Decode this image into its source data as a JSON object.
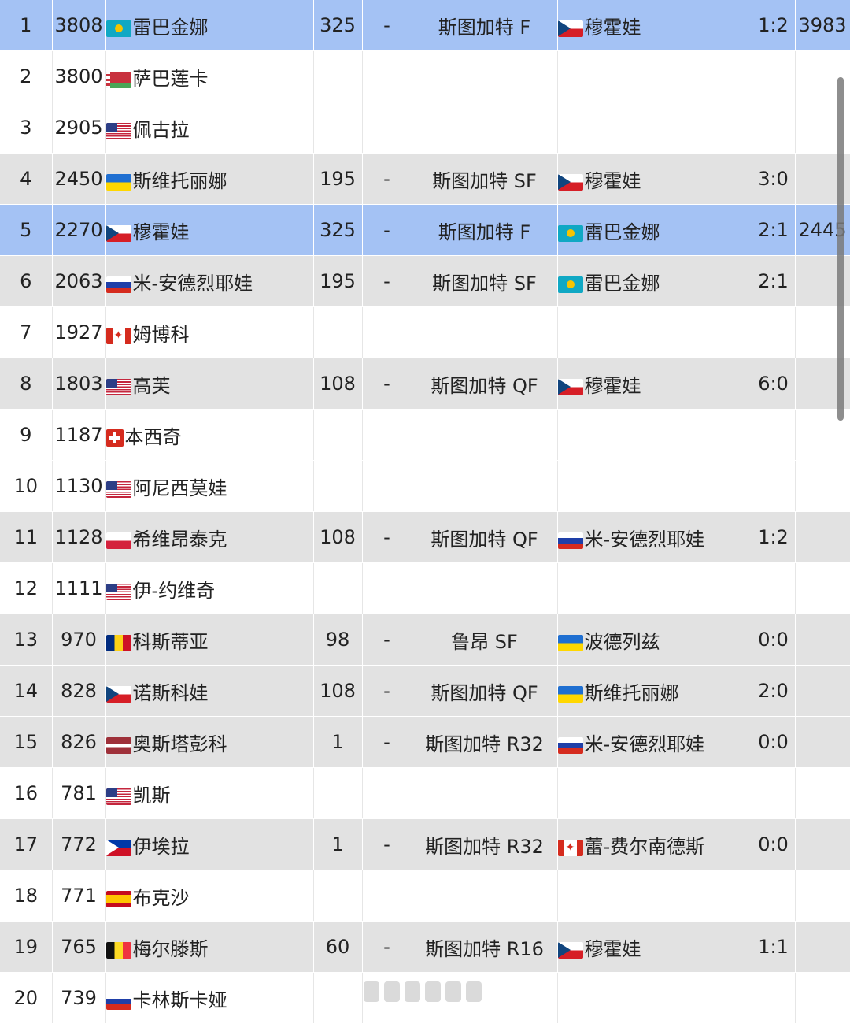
{
  "colors": {
    "highlight_row": "#a4c2f4",
    "grey_row": "#e2e2e2",
    "white_row": "#ffffff"
  },
  "rows": [
    {
      "rank": "1",
      "points": "3808",
      "flag": "kz",
      "player": "雷巴金娜",
      "prev_pts": "325",
      "dash": "-",
      "event": "斯图加特 F",
      "opp_flag": "cz",
      "opponent": "穆霍娃",
      "score": "1:2",
      "extra": "3983",
      "style": "blue"
    },
    {
      "rank": "2",
      "points": "3800",
      "flag": "by",
      "player": "萨巴莲卡",
      "prev_pts": "",
      "dash": "",
      "event": "",
      "opp_flag": "",
      "opponent": "",
      "score": "",
      "extra": "",
      "style": "white"
    },
    {
      "rank": "3",
      "points": "2905",
      "flag": "us",
      "player": "佩古拉",
      "prev_pts": "",
      "dash": "",
      "event": "",
      "opp_flag": "",
      "opponent": "",
      "score": "",
      "extra": "",
      "style": "white"
    },
    {
      "rank": "4",
      "points": "2450",
      "flag": "ua",
      "player": "斯维托丽娜",
      "prev_pts": "195",
      "dash": "-",
      "event": "斯图加特 SF",
      "opp_flag": "cz",
      "opponent": "穆霍娃",
      "score": "3:0",
      "extra": "",
      "style": "grey"
    },
    {
      "rank": "5",
      "points": "2270",
      "flag": "cz",
      "player": "穆霍娃",
      "prev_pts": "325",
      "dash": "-",
      "event": "斯图加特 F",
      "opp_flag": "kz",
      "opponent": "雷巴金娜",
      "score": "2:1",
      "extra": "2445",
      "style": "blue"
    },
    {
      "rank": "6",
      "points": "2063",
      "flag": "ru",
      "player": "米-安德烈耶娃",
      "prev_pts": "195",
      "dash": "-",
      "event": "斯图加特 SF",
      "opp_flag": "kz",
      "opponent": "雷巴金娜",
      "score": "2:1",
      "extra": "",
      "style": "grey"
    },
    {
      "rank": "7",
      "points": "1927",
      "flag": "ca",
      "player": "姆博科",
      "prev_pts": "",
      "dash": "",
      "event": "",
      "opp_flag": "",
      "opponent": "",
      "score": "",
      "extra": "",
      "style": "white"
    },
    {
      "rank": "8",
      "points": "1803",
      "flag": "us",
      "player": "高芙",
      "prev_pts": "108",
      "dash": "-",
      "event": "斯图加特 QF",
      "opp_flag": "cz",
      "opponent": "穆霍娃",
      "score": "6:0",
      "extra": "",
      "style": "grey"
    },
    {
      "rank": "9",
      "points": "1187",
      "flag": "ch",
      "player": "本西奇",
      "prev_pts": "",
      "dash": "",
      "event": "",
      "opp_flag": "",
      "opponent": "",
      "score": "",
      "extra": "",
      "style": "white"
    },
    {
      "rank": "10",
      "points": "1130",
      "flag": "us",
      "player": "阿尼西莫娃",
      "prev_pts": "",
      "dash": "",
      "event": "",
      "opp_flag": "",
      "opponent": "",
      "score": "",
      "extra": "",
      "style": "white"
    },
    {
      "rank": "11",
      "points": "1128",
      "flag": "pl",
      "player": "希维昂泰克",
      "prev_pts": "108",
      "dash": "-",
      "event": "斯图加特 QF",
      "opp_flag": "ru",
      "opponent": "米-安德烈耶娃",
      "score": "1:2",
      "extra": "",
      "style": "grey"
    },
    {
      "rank": "12",
      "points": "1111",
      "flag": "us",
      "player": "伊-约维奇",
      "prev_pts": "",
      "dash": "",
      "event": "",
      "opp_flag": "",
      "opponent": "",
      "score": "",
      "extra": "",
      "style": "white"
    },
    {
      "rank": "13",
      "points": "970",
      "flag": "ro",
      "player": "科斯蒂亚",
      "prev_pts": "98",
      "dash": "-",
      "event": "鲁昂 SF",
      "opp_flag": "ua",
      "opponent": "波德列兹",
      "score": "0:0",
      "extra": "",
      "style": "grey"
    },
    {
      "rank": "14",
      "points": "828",
      "flag": "cz",
      "player": "诺斯科娃",
      "prev_pts": "108",
      "dash": "-",
      "event": "斯图加特 QF",
      "opp_flag": "ua",
      "opponent": "斯维托丽娜",
      "score": "2:0",
      "extra": "",
      "style": "grey"
    },
    {
      "rank": "15",
      "points": "826",
      "flag": "lv",
      "player": "奥斯塔彭科",
      "prev_pts": "1",
      "dash": "-",
      "event": "斯图加特 R32",
      "opp_flag": "ru",
      "opponent": "米-安德烈耶娃",
      "score": "0:0",
      "extra": "",
      "style": "grey"
    },
    {
      "rank": "16",
      "points": "781",
      "flag": "us",
      "player": "凯斯",
      "prev_pts": "",
      "dash": "",
      "event": "",
      "opp_flag": "",
      "opponent": "",
      "score": "",
      "extra": "",
      "style": "white"
    },
    {
      "rank": "17",
      "points": "772",
      "flag": "ph",
      "player": "伊埃拉",
      "prev_pts": "1",
      "dash": "-",
      "event": "斯图加特 R32",
      "opp_flag": "ca",
      "opponent": "蕾-费尔南德斯",
      "score": "0:0",
      "extra": "",
      "style": "grey"
    },
    {
      "rank": "18",
      "points": "771",
      "flag": "es",
      "player": "布克沙",
      "prev_pts": "",
      "dash": "",
      "event": "",
      "opp_flag": "",
      "opponent": "",
      "score": "",
      "extra": "",
      "style": "white"
    },
    {
      "rank": "19",
      "points": "765",
      "flag": "be",
      "player": "梅尔滕斯",
      "prev_pts": "60",
      "dash": "-",
      "event": "斯图加特 R16",
      "opp_flag": "cz",
      "opponent": "穆霍娃",
      "score": "1:1",
      "extra": "",
      "style": "grey"
    },
    {
      "rank": "20",
      "points": "739",
      "flag": "ru",
      "player": "卡林斯卡娅",
      "prev_pts": "",
      "dash": "",
      "event": "",
      "opp_flag": "",
      "opponent": "",
      "score": "",
      "extra": "",
      "style": "white"
    }
  ]
}
